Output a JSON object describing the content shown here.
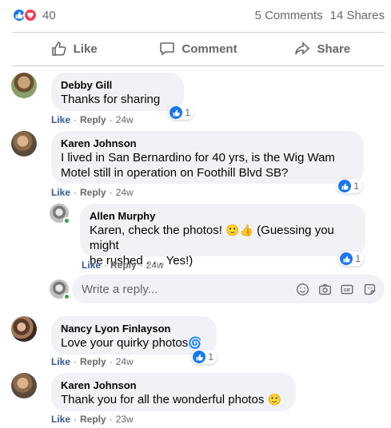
{
  "stats": {
    "reaction_count": "40",
    "comments": "5 Comments",
    "shares": "14 Shares",
    "like_color": "#1877f2",
    "love_color": "#f33e58"
  },
  "actions": {
    "like": "Like",
    "comment": "Comment",
    "share": "Share"
  },
  "comments": [
    {
      "author": "Debby Gill",
      "text": "Thanks for sharing",
      "like_label": "Like",
      "reply_label": "Reply",
      "time": "24w",
      "reactions": "1"
    },
    {
      "author": "Karen Johnson",
      "text_line1": "I lived in San Bernardino for 40 yrs, is the Wig Wam",
      "text_line2": "Motel still in operation on Foothill Blvd SB?",
      "like_label": "Like",
      "reply_label": "Reply",
      "time": "24w",
      "reactions": "1"
    },
    {
      "author": "Allen Murphy",
      "text_line1": "Karen, check the photos!",
      "text_line1b": "(Guessing you might",
      "text_line2": "be rushed . . . Yes!)",
      "like_label": "Like",
      "reply_label": "Reply",
      "time": "24w",
      "reactions": "1"
    },
    {
      "author": "Nancy Lyon Finlayson",
      "text": "Love your quirky photos",
      "like_label": "Like",
      "reply_label": "Reply",
      "time": "24w",
      "reactions": "1"
    },
    {
      "author": "Karen Johnson",
      "text": "Thank you for all the wonderful photos",
      "like_label": "Like",
      "reply_label": "Reply",
      "time": "23w"
    }
  ],
  "reply_input": {
    "placeholder": "Write a reply..."
  },
  "icons": {
    "emoji": "emoji-icon",
    "camera": "camera-icon",
    "gif": "gif-icon",
    "sticker": "sticker-icon"
  }
}
